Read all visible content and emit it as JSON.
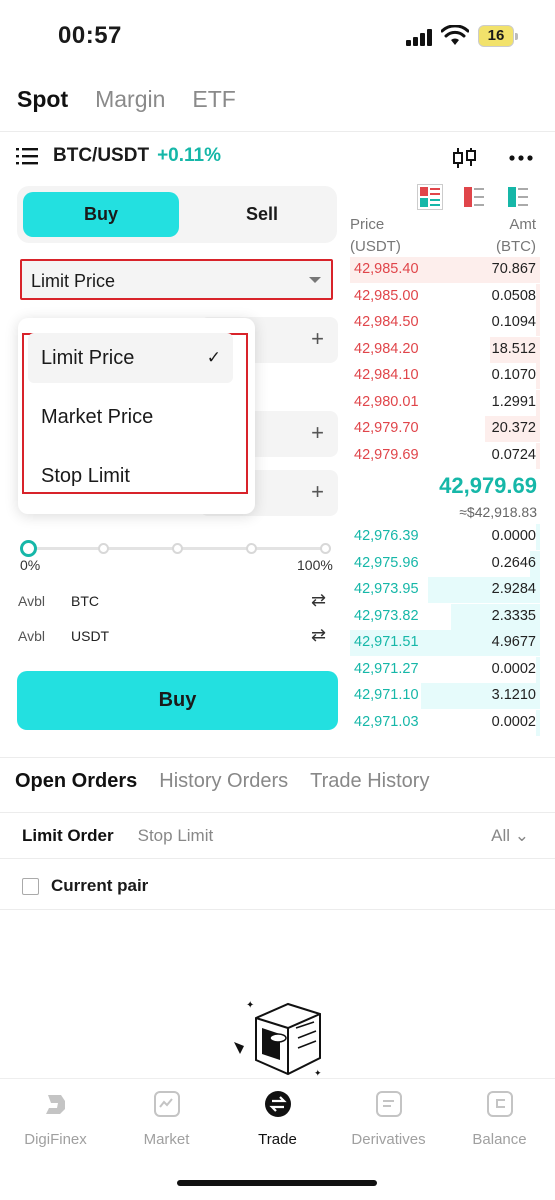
{
  "status_bar": {
    "time": "00:57",
    "battery": "16"
  },
  "top_tabs": [
    "Spot",
    "Margin",
    "ETF"
  ],
  "pair": {
    "name": "BTC/USDT",
    "change": "+0.11%"
  },
  "trade_toggle": {
    "buy": "Buy",
    "sell": "Sell"
  },
  "order_type": {
    "selected": "Limit Price"
  },
  "dropdown": {
    "options": [
      "Limit Price",
      "Market Price",
      "Stop Limit"
    ],
    "selected_index": 0
  },
  "slider": {
    "min_label": "0%",
    "max_label": "100%",
    "value_percent": 0
  },
  "available": [
    {
      "label": "Avbl",
      "currency": "BTC"
    },
    {
      "label": "Avbl",
      "currency": "USDT"
    }
  ],
  "buy_button": "Buy",
  "order_book": {
    "price_header": [
      "Price",
      "(USDT)"
    ],
    "amount_header": [
      "Amt",
      "(BTC)"
    ],
    "asks": [
      {
        "price": "42,985.40",
        "amount": "70.867"
      },
      {
        "price": "42,985.00",
        "amount": "0.0508"
      },
      {
        "price": "42,984.50",
        "amount": "0.1094"
      },
      {
        "price": "42,984.20",
        "amount": "18.512"
      },
      {
        "price": "42,984.10",
        "amount": "0.1070"
      },
      {
        "price": "42,980.01",
        "amount": "1.2991"
      },
      {
        "price": "42,979.70",
        "amount": "20.372"
      },
      {
        "price": "42,979.69",
        "amount": "0.0724"
      }
    ],
    "last_price": "42,979.69",
    "last_fiat": "≈$42,918.83",
    "bids": [
      {
        "price": "42,976.39",
        "amount": "0.0000"
      },
      {
        "price": "42,975.96",
        "amount": "0.2646"
      },
      {
        "price": "42,973.95",
        "amount": "2.9284"
      },
      {
        "price": "42,973.82",
        "amount": "2.3335"
      },
      {
        "price": "42,971.51",
        "amount": "4.9677"
      },
      {
        "price": "42,971.27",
        "amount": "0.0002"
      },
      {
        "price": "42,971.10",
        "amount": "3.1210"
      },
      {
        "price": "42,971.03",
        "amount": "0.0002"
      }
    ]
  },
  "order_tabs": [
    "Open Orders",
    "History Orders",
    "Trade History"
  ],
  "sub_tabs": [
    "Limit Order",
    "Stop Limit"
  ],
  "filter_all": "All",
  "current_pair_label": "Current pair",
  "bottom_nav": [
    "DigiFinex",
    "Market",
    "Trade",
    "Derivatives",
    "Balance"
  ],
  "colors": {
    "accent": "#23e0e0",
    "buy_green": "#16b7a8",
    "sell_red": "#e0454a",
    "highlight": "#d8232a"
  }
}
